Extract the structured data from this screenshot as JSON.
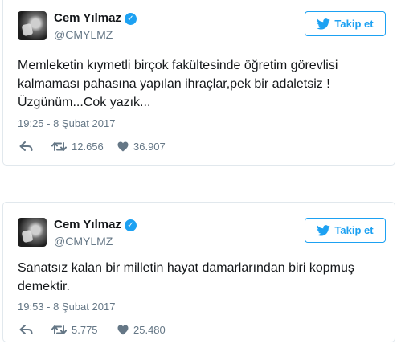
{
  "colors": {
    "accent": "#1da1f2",
    "secondary_text": "#657786",
    "border": "#e1e8ed"
  },
  "tweets": [
    {
      "author_name": "Cem Yılmaz",
      "handle": "@CMYLMZ",
      "follow_label": "Takip et",
      "text": "Memleketin kıymetli birçok fakültesinde öğretim görevlisi\nkalmaması pahasına yapılan ihraçlar,pek bir adaletsiz !\nÜzgünüm...Cok yazık...",
      "timestamp": "19:25 - 8 Şubat 2017",
      "retweets": "12.656",
      "likes": "36.907"
    },
    {
      "author_name": "Cem Yılmaz",
      "handle": "@CMYLMZ",
      "follow_label": "Takip et",
      "text": "Sanatsız kalan bir milletin hayat damarlarından biri kopmuş\ndemektir.",
      "timestamp": "19:53 - 8 Şubat 2017",
      "retweets": "5.775",
      "likes": "25.480"
    }
  ],
  "icons": {
    "verified": "verified-badge-icon",
    "follow": "twitter-bird-icon",
    "reply": "reply-arrow-icon",
    "retweet": "retweet-icon",
    "like": "heart-icon"
  }
}
